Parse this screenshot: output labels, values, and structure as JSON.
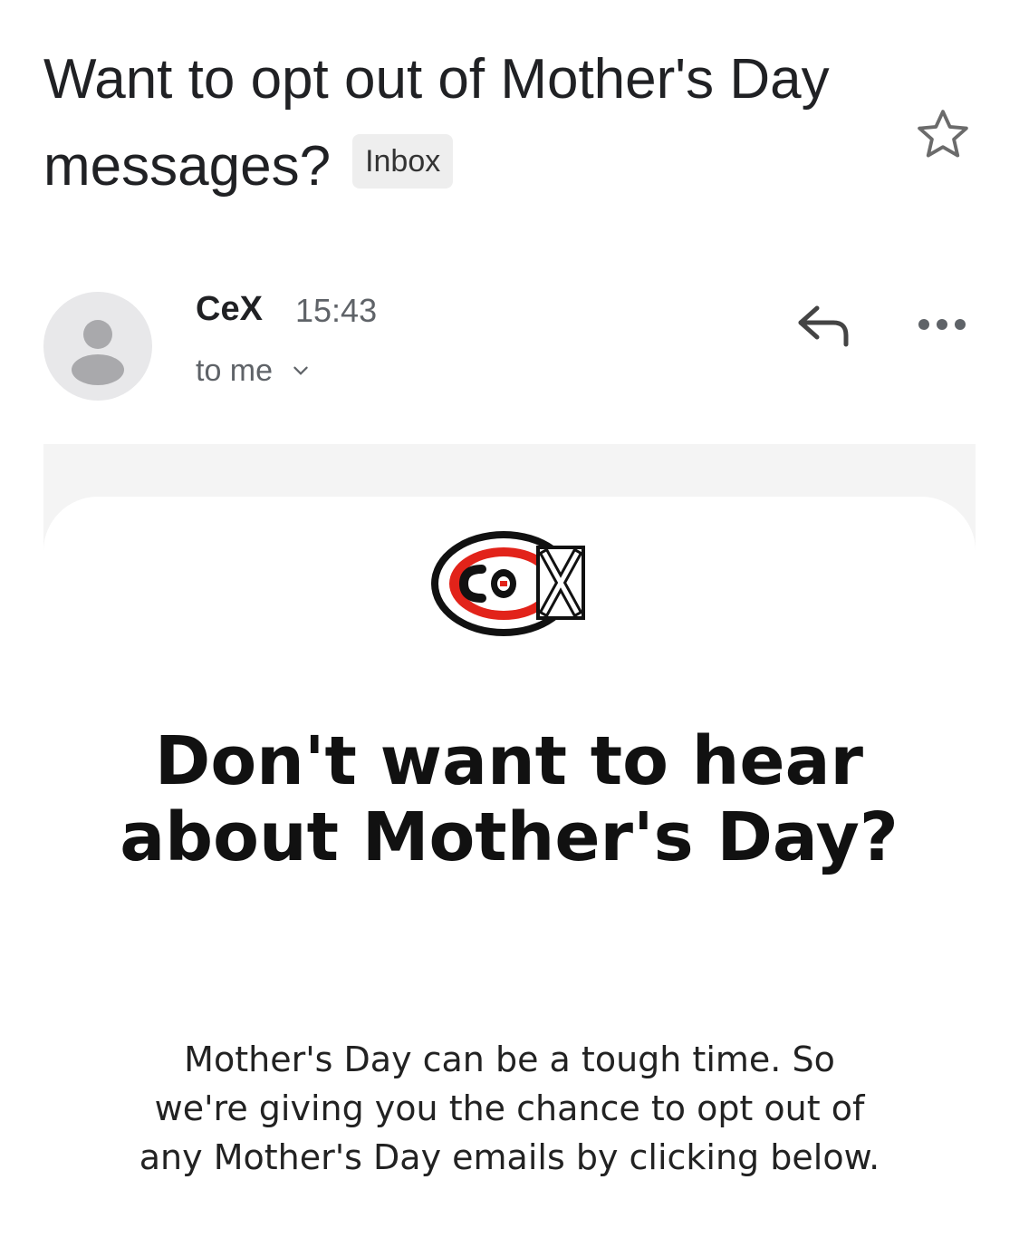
{
  "header": {
    "subject": "Want to opt out of Mother's Day messages?",
    "label": "Inbox",
    "star_icon": "star-outline-icon"
  },
  "message": {
    "sender": "CeX",
    "time": "15:43",
    "recipient": "to me",
    "avatar_icon": "person-icon",
    "reply_icon": "reply-arrow-icon",
    "more_icon": "more-horizontal-icon"
  },
  "email_body": {
    "logo_text": "CeX",
    "headline": "Don't want to hear about Mother's Day?",
    "paragraph": "Mother's Day can be a tough time. So we're giving you the chance to opt out of any Mother's Day emails by clicking below."
  },
  "colors": {
    "brand_red": "#e2231a",
    "chip_bg": "#eeeeee",
    "frame_bg": "#f4f4f4",
    "avatar_bg": "#e8e8ea"
  }
}
